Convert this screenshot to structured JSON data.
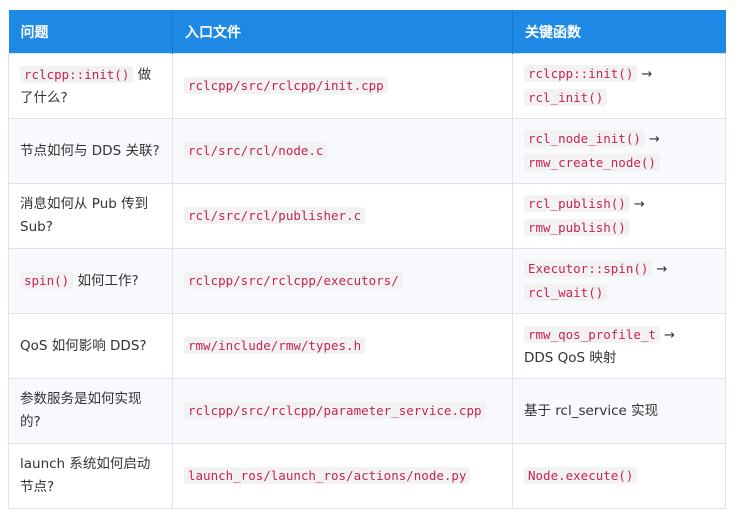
{
  "headers": [
    "问题",
    "入口文件",
    "关键函数"
  ],
  "rows": [
    {
      "q_code": "rclcpp::init()",
      "q_text": " 做了什么?",
      "file": "rclcpp/src/rclcpp/init.cpp",
      "fn1": "rclcpp::init()",
      "arrow": "→",
      "fn2": "rcl_init()"
    },
    {
      "q_text": "节点如何与 DDS 关联?",
      "file": "rcl/src/rcl/node.c",
      "fn1": "rcl_node_init()",
      "arrow": "→",
      "fn2": "rmw_create_node()"
    },
    {
      "q_text": "消息如何从 Pub 传到 Sub?",
      "file": "rcl/src/rcl/publisher.c",
      "fn1": "rcl_publish()",
      "arrow": "→",
      "fn2": "rmw_publish()"
    },
    {
      "q_code": "spin()",
      "q_text": " 如何工作?",
      "file": "rclcpp/src/rclcpp/executors/",
      "fn1": "Executor::spin()",
      "arrow": "→",
      "fn2": "rcl_wait()"
    },
    {
      "q_text": "QoS 如何影响 DDS?",
      "file": "rmw/include/rmw/types.h",
      "fn1": "rmw_qos_profile_t",
      "arrow": "→",
      "fn2_text": "DDS QoS 映射"
    },
    {
      "q_text": "参数服务是如何实现的?",
      "file": "rclcpp/src/rclcpp/parameter_service.cpp",
      "fn_text": "基于 rcl_service 实现"
    },
    {
      "q_text": "launch 系统如何启动节点?",
      "file": "launch_ros/launch_ros/actions/node.py",
      "fn1": "Node.execute()"
    }
  ]
}
